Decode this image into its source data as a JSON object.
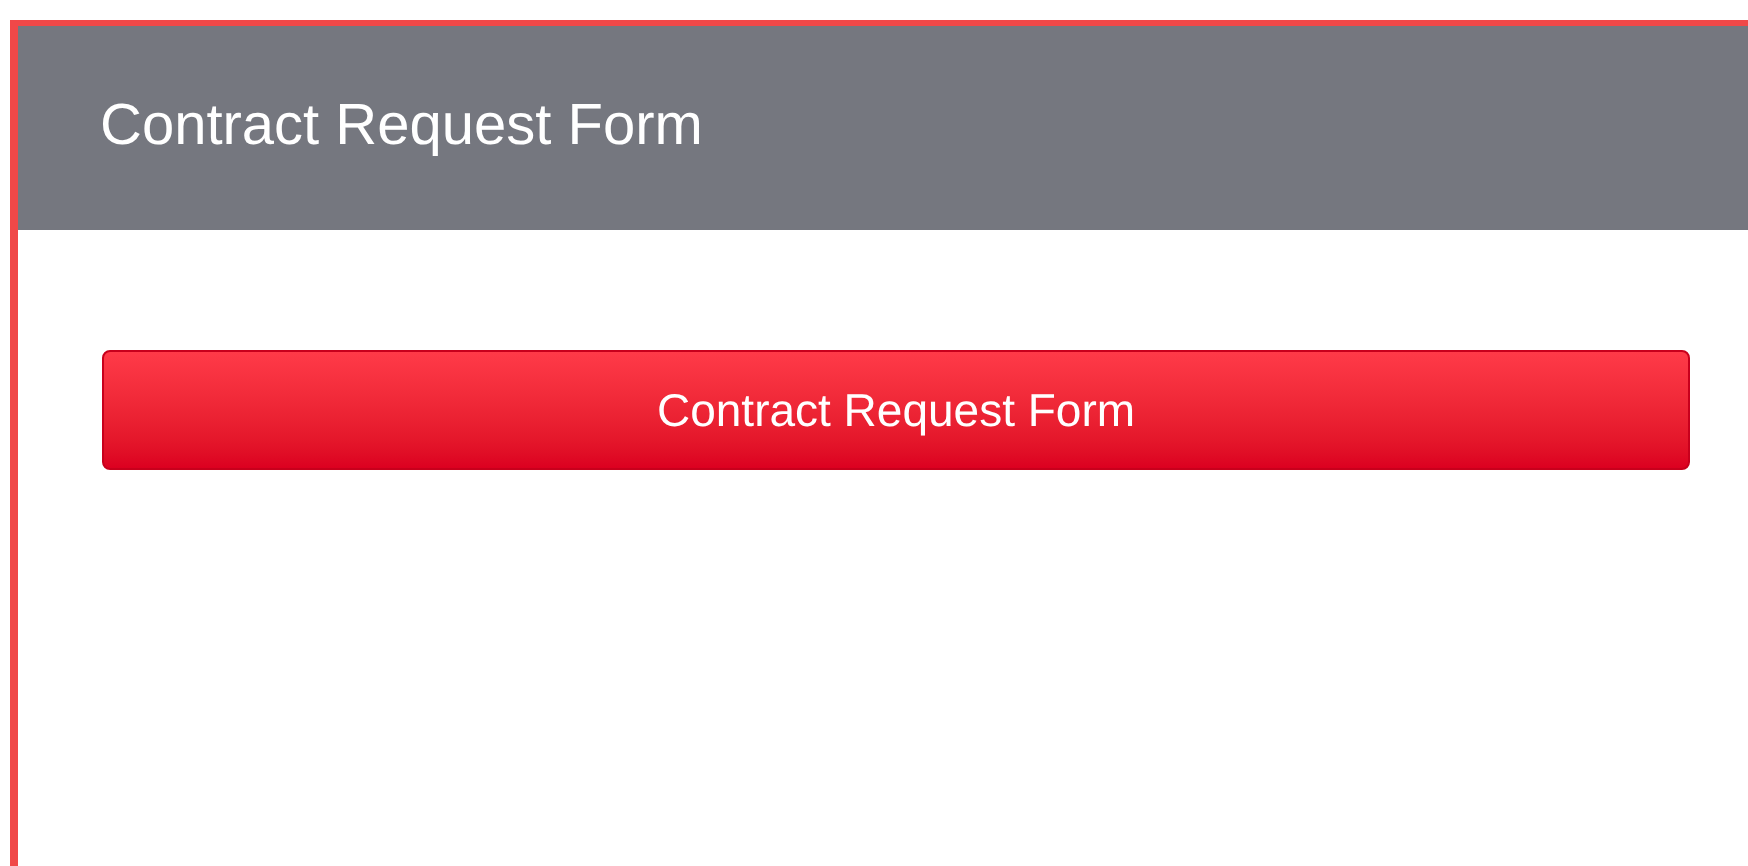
{
  "header": {
    "title": "Contract Request Form"
  },
  "buttons": [
    {
      "label": "Contract Request Form"
    }
  ]
}
